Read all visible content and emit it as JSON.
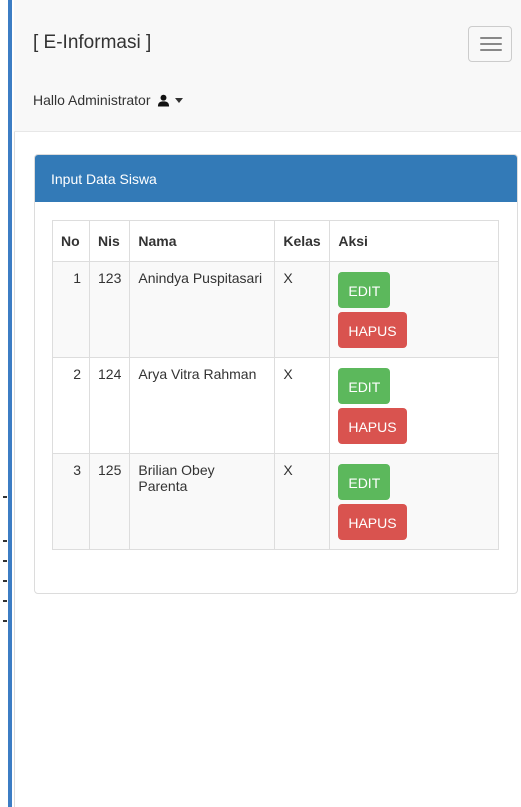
{
  "navbar": {
    "brand": "[ E-Informasi ]",
    "user_greeting": "Hallo Administrator",
    "icons": {
      "toggle": "hamburger-menu-icon",
      "user": "user-icon",
      "caret": "caret-down-icon"
    }
  },
  "panel": {
    "heading": "Input Data Siswa",
    "table": {
      "headers": [
        "No",
        "Nis",
        "Nama",
        "Kelas",
        "Aksi"
      ],
      "rows": [
        {
          "no": "1",
          "nis": "123",
          "nama": "Anindya Puspitasari",
          "kelas": "X",
          "edit": "EDIT",
          "hapus": "HAPUS"
        },
        {
          "no": "2",
          "nis": "124",
          "nama": "Arya Vitra Rahman",
          "kelas": "X",
          "edit": "EDIT",
          "hapus": "HAPUS"
        },
        {
          "no": "3",
          "nis": "125",
          "nama": "Brilian Obey Parenta",
          "kelas": "X",
          "edit": "EDIT",
          "hapus": "HAPUS"
        }
      ]
    }
  },
  "colors": {
    "panel_primary": "#337ab7",
    "edit_button": "#5cb85c",
    "hapus_button": "#d9534f"
  }
}
